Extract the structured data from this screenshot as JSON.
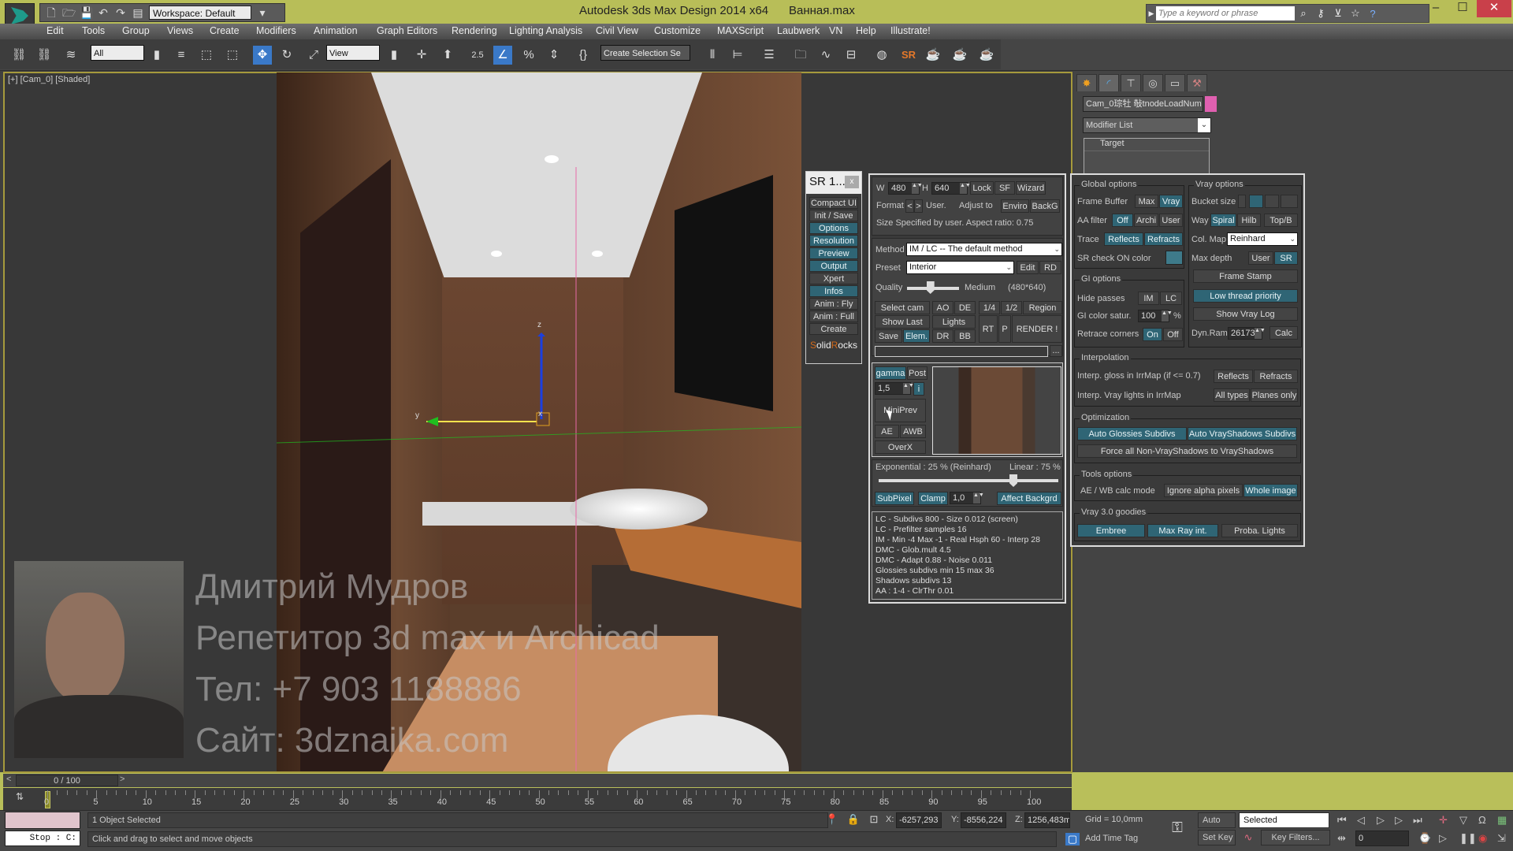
{
  "titlebar": {
    "logo_label": "MXD",
    "workspace": "Workspace: Default",
    "app_title": "Autodesk 3ds Max Design 2014 x64",
    "file_name": "Ванная.max",
    "search_placeholder": "Type a keyword or phrase",
    "icons": [
      "new-file-icon",
      "open-icon",
      "save-icon",
      "undo-icon",
      "redo-icon",
      "project-folder-icon"
    ],
    "help_icons": [
      "binoculars-icon",
      "key-icon",
      "satellite-icon",
      "star-icon",
      "help-icon"
    ],
    "window_buttons": {
      "minimize": "–",
      "maximize": "☐",
      "close": "✕"
    }
  },
  "menubar": [
    "Edit",
    "Tools",
    "Group",
    "Views",
    "Create",
    "Modifiers",
    "Animation",
    "Graph Editors",
    "Rendering",
    "Lighting Analysis",
    "Civil View",
    "Customize",
    "MAXScript",
    "Laubwerk",
    "VN",
    "Help",
    "Illustrate!"
  ],
  "toolbar": {
    "selection_filter": "All",
    "ref_coord": "View",
    "snap_value": "2.5",
    "named_selection": "Create Selection Se",
    "sr_label": "SR"
  },
  "viewport": {
    "label": "[+] [Cam_0] [Shaded]",
    "watermark": [
      "Дмитрий Мудров",
      "Репетитор 3d max и Archicad",
      "Тел: +7 903 1188886",
      "Сайт: 3dznaika.com"
    ],
    "axis_x": "x",
    "axis_y": "y",
    "axis_z": "z"
  },
  "command_panel": {
    "tabs": [
      "create",
      "modify",
      "hierarchy",
      "motion",
      "display",
      "utilities"
    ],
    "object_name": "Cam_0琮牡 敧tnodeLoadNum",
    "object_color": "#e060b0",
    "modifier_list": "Modifier List",
    "stack": [
      "Target"
    ]
  },
  "sr_side": {
    "title": "SR 1...",
    "close": "x",
    "buttons": [
      {
        "label": "Compact UI",
        "on": false
      },
      {
        "label": "Init / Save",
        "on": false
      },
      {
        "label": "Options",
        "on": true
      },
      {
        "label": "Resolution",
        "on": true
      },
      {
        "label": "Preview",
        "on": true
      },
      {
        "label": "Output",
        "on": true
      },
      {
        "label": "Xpert",
        "on": false
      },
      {
        "label": "Infos",
        "on": true
      },
      {
        "label": "Anim : Fly",
        "on": false
      },
      {
        "label": "Anim : Full",
        "on": false
      },
      {
        "label": "Create",
        "on": false
      }
    ],
    "brand_s": "S",
    "brand_olid": "olid",
    "brand_r": "R",
    "brand_ocks": "ocks"
  },
  "sr_main": {
    "w_label": "W",
    "w_value": "480",
    "h_label": "H",
    "h_value": "640",
    "lock": "Lock",
    "sf": "SF",
    "wizard": "Wizard",
    "format_label": "Format",
    "prev": "<",
    "next": ">",
    "format_value": "User.",
    "adjust_label": "Adjust to",
    "enviro": "Enviro",
    "backg": "BackG",
    "size_text": "Size   Specified by user. Aspect ratio: 0.75",
    "method_label": "Method",
    "method_value": "IM / LC -- The default method",
    "preset_label": "Preset",
    "preset_value": "Interior",
    "edit": "Edit",
    "rd": "RD",
    "quality_label": "Quality",
    "quality_value": "Medium",
    "quality_res": "(480*640)",
    "quality_level": 0.45,
    "select_cam": "Select cam",
    "ao": "AO",
    "de": "DE",
    "q14": "1/4",
    "q12": "1/2",
    "region": "Region",
    "show_last": "Show Last",
    "lights": "Lights",
    "rt": "RT",
    "p": "P",
    "render": "RENDER !",
    "save": "Save",
    "elem": "Elem.",
    "dr": "DR",
    "bb": "BB",
    "output_path": "",
    "browse": "...",
    "gamma": "gamma",
    "post": "Post",
    "gamma_value": "1,5",
    "info": "i",
    "miniprev": "MiniPrev",
    "ae": "AE",
    "awb": "AWB",
    "overx": "OverX",
    "exp_label": "Exponential : 25 %  (Reinhard)",
    "lin_label": "Linear : 75 %",
    "exp_lin_mix": 0.75,
    "subpixel": "SubPixel",
    "clamp": "Clamp",
    "clamp_value": "1,0",
    "affect_bg": "Affect Backgrd",
    "info_lines": [
      "LC - Subdivs 800 - Size 0.012 (screen)",
      "LC - Prefilter samples 16",
      "IM - Min -4 Max -1 - Real Hsph 60 - Interp 28",
      "DMC - Glob.mult 4.5",
      "DMC - Adapt 0.88 - Noise 0.011",
      "Glossies subdivs min 15 max 36",
      "Shadows subdivs 13",
      "AA : 1-4 - ClrThr 0.01"
    ]
  },
  "sr_opts": {
    "global_title": "Global options",
    "frame_buffer": "Frame Buffer",
    "fb_max": "Max",
    "fb_vray": "Vray",
    "aa_filter": "AA filter",
    "aa_off": "Off",
    "aa_archi": "Archi",
    "aa_user": "User",
    "trace": "Trace",
    "reflects": "Reflects",
    "refracts": "Refracts",
    "sr_check": "SR check ON color",
    "sr_check_color": "#3e7a8a",
    "vray_title": "Vray options",
    "bucket": "Bucket size",
    "way": "Way",
    "spiral": "Spiral",
    "hilb": "Hilb",
    "topb": "Top/B",
    "colmap": "Col. Map",
    "colmap_value": "Reinhard",
    "maxdepth": "Max depth",
    "md_user": "User",
    "md_sr": "SR",
    "frame_stamp": "Frame Stamp",
    "low_thread": "Low thread priority",
    "show_log": "Show Vray Log",
    "dynram": "Dyn.Ram",
    "dynram_value": "26173",
    "calc": "Calc",
    "gi_title": "GI options",
    "hide_passes": "Hide passes",
    "im": "IM",
    "lc": "LC",
    "gi_satur": "GI color satur.",
    "gi_satur_value": "100",
    "pct": "%",
    "retrace": "Retrace corners",
    "on": "On",
    "off": "Off",
    "interp_title": "Interpolation",
    "interp_gloss": "Interp. gloss in IrrMap (if <= 0.7)",
    "ig_reflects": "Reflects",
    "ig_refracts": "Refracts",
    "interp_lights": "Interp. Vray lights in IrrMap",
    "all_types": "All types",
    "planes_only": "Planes only",
    "optim_title": "Optimization",
    "auto_glossies": "Auto Glossies Subdivs",
    "auto_shadows": "Auto VrayShadows Subdivs",
    "force_shadows": "Force all Non-VrayShadows to VrayShadows",
    "tools_title": "Tools options",
    "aewb": "AE / WB calc mode",
    "ignore_alpha": "Ignore alpha pixels",
    "whole_image": "Whole image",
    "goodies_title": "Vray 3.0 goodies",
    "embree": "Embree",
    "max_ray": "Max Ray int.",
    "proba_lights": "Proba. Lights"
  },
  "timeline": {
    "frame": "0 / 100",
    "prev": "<",
    "next": ">",
    "ticks": [
      "0",
      "5",
      "10",
      "15",
      "20",
      "25",
      "30",
      "35",
      "40",
      "45",
      "50",
      "55",
      "60",
      "65",
      "70",
      "75",
      "80",
      "85",
      "90",
      "95",
      "100"
    ]
  },
  "status": {
    "script_stop": "Stop   : C:",
    "selection": "1 Object Selected",
    "prompt": "Click and drag to select and move objects",
    "x_label": "X:",
    "x_value": "-6257,293",
    "y_label": "Y:",
    "y_value": "-8556,224",
    "z_label": "Z:",
    "z_value": "1256,483m",
    "grid": "Grid = 10,0mm",
    "add_time_tag": "Add Time Tag",
    "auto_key": "Auto Key",
    "set_key": "Set Key",
    "key_mode": "Selected",
    "key_filters": "Key Filters...",
    "current_frame": "0"
  }
}
